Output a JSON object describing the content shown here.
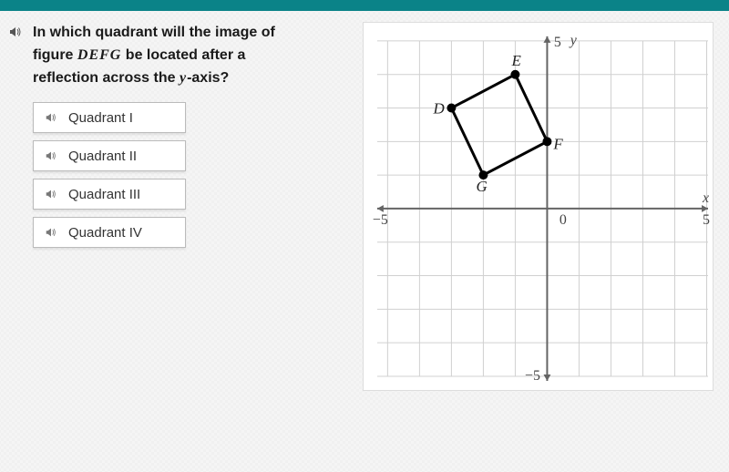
{
  "question": {
    "line1": "In which quadrant will the image of",
    "line2_pre": "figure ",
    "line2_math": "DEFG",
    "line2_post": " be located after a",
    "line3_pre": "reflection across the ",
    "line3_math": "y",
    "line3_post": "-axis?"
  },
  "options": [
    {
      "label": "Quadrant I"
    },
    {
      "label": "Quadrant II"
    },
    {
      "label": "Quadrant III"
    },
    {
      "label": "Quadrant IV"
    }
  ],
  "chart_data": {
    "type": "scatter",
    "x_range": [
      -5,
      5
    ],
    "y_range": [
      -5,
      5
    ],
    "x_axis_var": "x",
    "y_axis_var": "y",
    "ticks": {
      "neg": "−5",
      "pos": "5",
      "zero": "0"
    },
    "figure": "DEFG",
    "points": {
      "D": {
        "x": -3,
        "y": 3,
        "label_dx": -20,
        "label_dy": 6
      },
      "E": {
        "x": -1,
        "y": 4,
        "label_dx": -4,
        "label_dy": -10
      },
      "F": {
        "x": 0,
        "y": 2,
        "label_dx": 7,
        "label_dy": 8
      },
      "G": {
        "x": -2,
        "y": 1,
        "label_dx": -8,
        "label_dy": 18
      }
    }
  }
}
